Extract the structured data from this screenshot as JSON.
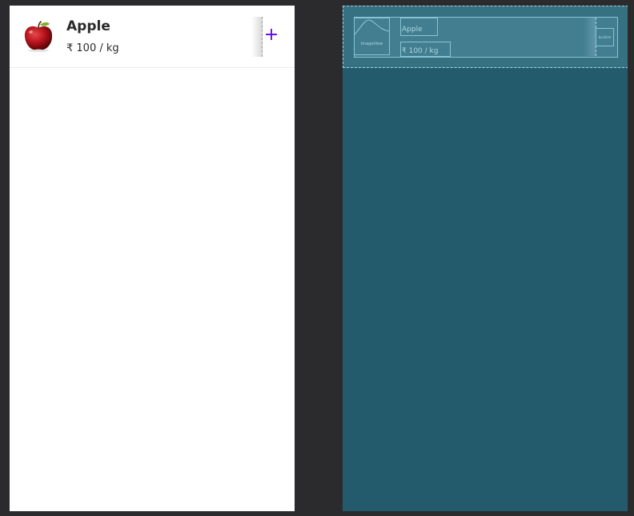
{
  "design_preview": {
    "item": {
      "name": "Apple",
      "price": "₹ 100 / kg",
      "image_icon": "apple-image",
      "add_icon": "plus-icon",
      "add_symbol": "+"
    },
    "accent_color": "#6200ee",
    "background_color": "#ffffff"
  },
  "blueprint_preview": {
    "image_label": "ImageView",
    "name_text": "Apple",
    "price_text": "₹ 100 / kg",
    "button_label": "bucklim",
    "background_color": "#245b6c",
    "outline_color": "#86c3d3"
  }
}
